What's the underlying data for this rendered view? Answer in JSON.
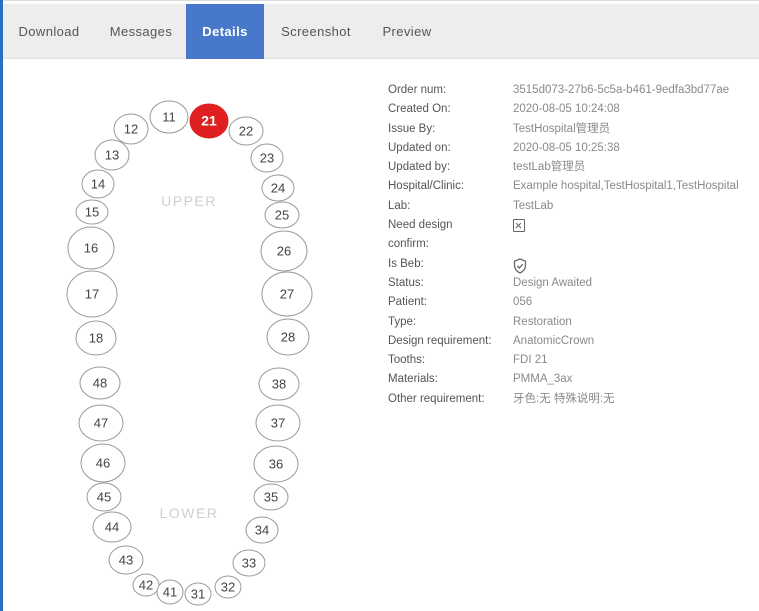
{
  "tabs": [
    {
      "label": "Download",
      "active": false
    },
    {
      "label": "Messages",
      "active": false
    },
    {
      "label": "Details",
      "active": true
    },
    {
      "label": "Screenshot",
      "active": false
    },
    {
      "label": "Preview",
      "active": false
    }
  ],
  "tooth_chart": {
    "upper_label": "UPPER",
    "lower_label": "LOWER",
    "selected_tooth": "21",
    "selected_color": "#e02020",
    "upper_teeth": [
      "11",
      "12",
      "13",
      "14",
      "15",
      "16",
      "17",
      "18",
      "21",
      "22",
      "23",
      "24",
      "25",
      "26",
      "27",
      "28"
    ],
    "lower_teeth": [
      "48",
      "47",
      "46",
      "45",
      "44",
      "43",
      "42",
      "41",
      "31",
      "32",
      "33",
      "34",
      "35",
      "36",
      "37",
      "38"
    ]
  },
  "details": {
    "order_num": {
      "label": "Order num:",
      "value": "3515d073-27b6-5c5a-b461-9edfa3bd77ae"
    },
    "created_on": {
      "label": "Created On:",
      "value": "2020-08-05 10:24:08"
    },
    "issue_by": {
      "label": "Issue By:",
      "value": "TestHospital管理员"
    },
    "updated_on": {
      "label": "Updated on:",
      "value": "2020-08-05 10:25:38"
    },
    "updated_by": {
      "label": "Updated by:",
      "value": "testLab管理员"
    },
    "hospital": {
      "label": "Hospital/Clinic:",
      "value": "Example hospital,TestHospital1,TestHospital"
    },
    "lab": {
      "label": "Lab:",
      "value": "TestLab"
    },
    "need_design_confirm": {
      "label": "Need design confirm:",
      "icon": "unchecked-box-icon"
    },
    "is_beb": {
      "label": "Is Beb:",
      "icon": "shield-check-icon"
    },
    "status": {
      "label": "Status:",
      "value": "Design Awaited"
    },
    "patient": {
      "label": "Patient:",
      "value": "056"
    },
    "type": {
      "label": "Type:",
      "value": "Restoration"
    },
    "design_requirement": {
      "label": "Design requirement:",
      "value": "AnatomicCrown"
    },
    "tooths": {
      "label": "Tooths:",
      "value": "FDI 21"
    },
    "materials": {
      "label": "Materials:",
      "value": "PMMA_3ax"
    },
    "other_requirement": {
      "label": "Other requirement:",
      "value": "牙色:无 特殊说明:无"
    }
  }
}
